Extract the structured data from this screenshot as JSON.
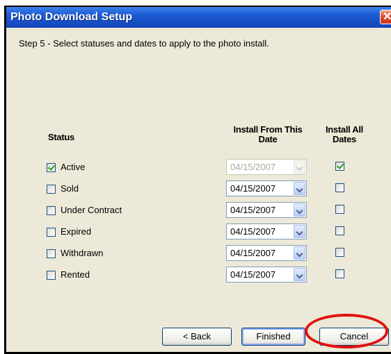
{
  "window": {
    "title": "Photo Download Setup",
    "close_glyph": "✕"
  },
  "step_text": "Step 5 - Select statuses and dates to apply to the photo install.",
  "headers": {
    "status": "Status",
    "install_from": "Install From This Date",
    "install_all": "Install All Dates"
  },
  "rows": [
    {
      "label": "Active",
      "checked": true,
      "date": "04/15/2007",
      "date_enabled": false,
      "install_all": true
    },
    {
      "label": "Sold",
      "checked": false,
      "date": "04/15/2007",
      "date_enabled": true,
      "install_all": false
    },
    {
      "label": "Under Contract",
      "checked": false,
      "date": "04/15/2007",
      "date_enabled": true,
      "install_all": false
    },
    {
      "label": "Expired",
      "checked": false,
      "date": "04/15/2007",
      "date_enabled": true,
      "install_all": false
    },
    {
      "label": "Withdrawn",
      "checked": false,
      "date": "04/15/2007",
      "date_enabled": true,
      "install_all": false
    },
    {
      "label": "Rented",
      "checked": false,
      "date": "04/15/2007",
      "date_enabled": true,
      "install_all": false
    }
  ],
  "buttons": {
    "back": "< Back",
    "finished": "Finished",
    "cancel": "Cancel"
  },
  "colors": {
    "titlebar": "#1f5ed6",
    "dialog_bg": "#ece9d8",
    "check": "#21a121",
    "annotation": "#e01010"
  }
}
